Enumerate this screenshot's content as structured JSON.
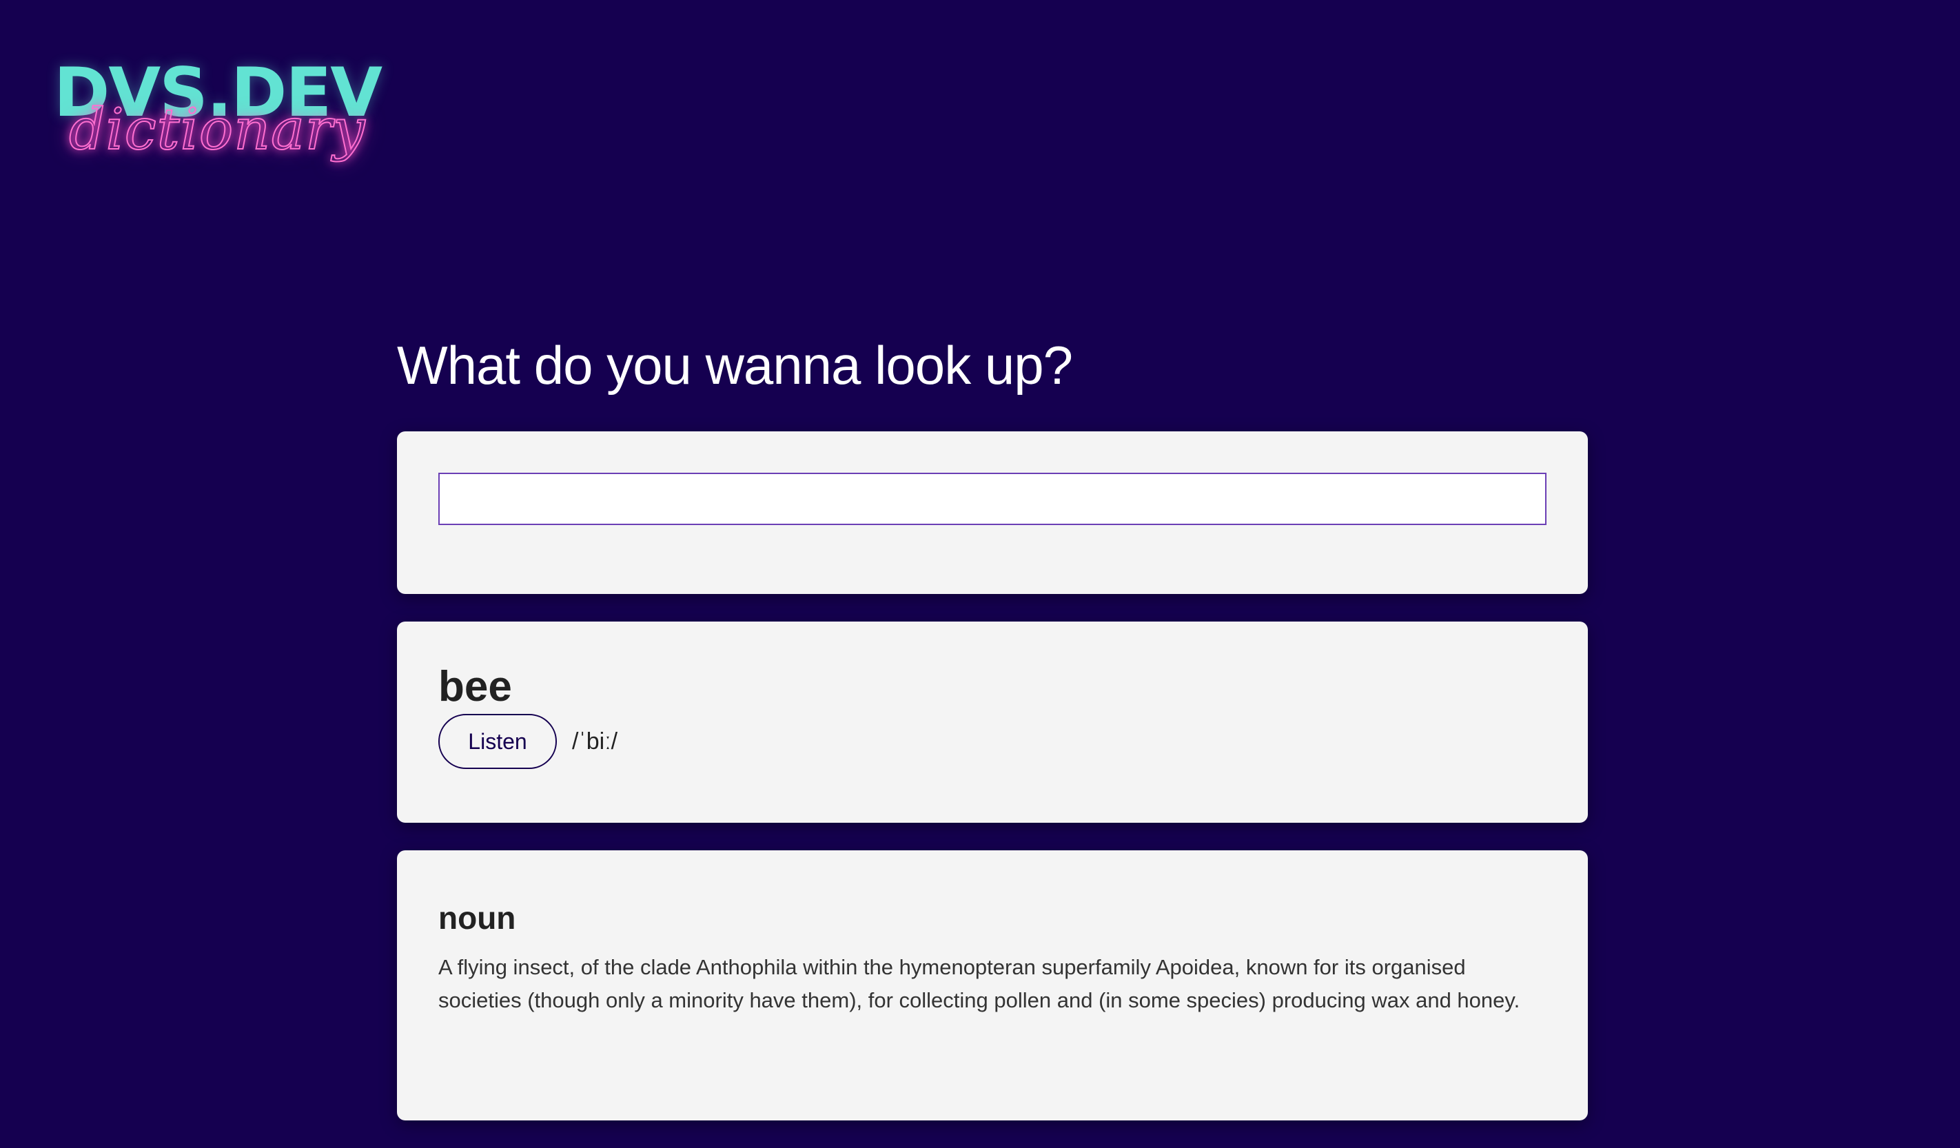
{
  "logo": {
    "main": "DVS.DEV",
    "script": "dictionary"
  },
  "headline": "What do you wanna look up?",
  "search": {
    "value": "",
    "placeholder": ""
  },
  "result": {
    "word": "bee",
    "listen_label": "Listen",
    "phonetic": "/ˈbiː/"
  },
  "meaning": {
    "part_of_speech": "noun",
    "definition": "A flying insect, of the clade Anthophila within the hymenopteran superfamily Apoidea, known for its organised societies (though only a minority have them), for collecting pollen and (in some species) producing wax and honey."
  },
  "colors": {
    "background": "#150050",
    "card": "#f4f4f4",
    "logo_main": "#62e3d3",
    "logo_script": "#ff6fd0",
    "accent": "#6b3fb5"
  }
}
